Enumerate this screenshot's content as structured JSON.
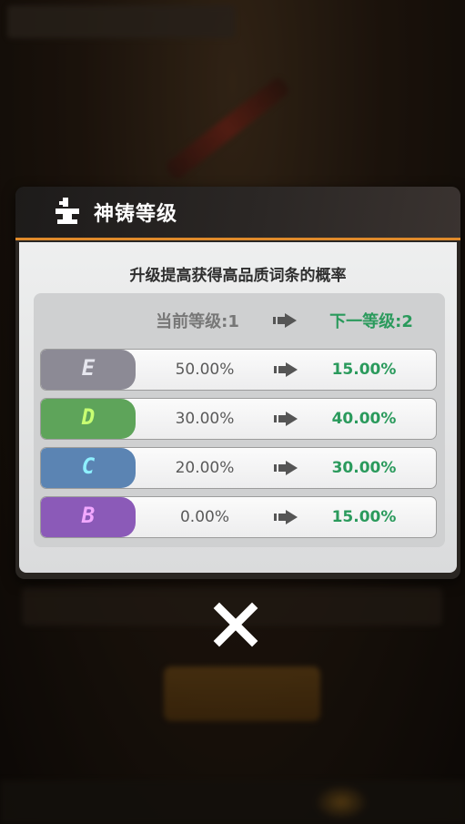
{
  "dialog": {
    "title": "神铸等级",
    "subtitle": "升级提高获得高品质词条的概率",
    "current_level_label": "当前等级:1",
    "next_level_label": "下一等级:2"
  },
  "rows": [
    {
      "grade": "E",
      "current": "50.00%",
      "next": "15.00%",
      "color": "#8c8a95"
    },
    {
      "grade": "D",
      "current": "30.00%",
      "next": "40.00%",
      "color": "#5ea45a"
    },
    {
      "grade": "C",
      "current": "20.00%",
      "next": "30.00%",
      "color": "#5b84b3"
    },
    {
      "grade": "B",
      "current": "0.00%",
      "next": "15.00%",
      "color": "#8b5ab8"
    }
  ],
  "colors": {
    "accent": "#e08a2a",
    "next_value": "#2a9a5c"
  },
  "icons": {
    "header": "anvil-icon",
    "arrow": "arrow-right-icon",
    "close": "close-icon"
  }
}
